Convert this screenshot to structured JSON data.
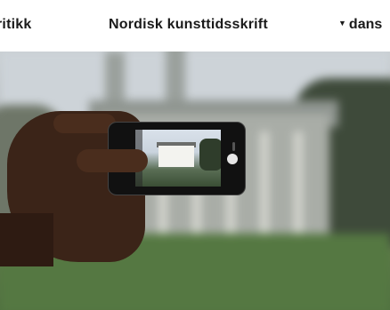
{
  "header": {
    "left_nav_label": "ritikk",
    "site_title": "Nordisk kunsttidsskrift",
    "language_label": "dans",
    "language_caret": "▼"
  },
  "hero": {
    "image_icon": "photo-hand-holding-phone"
  }
}
